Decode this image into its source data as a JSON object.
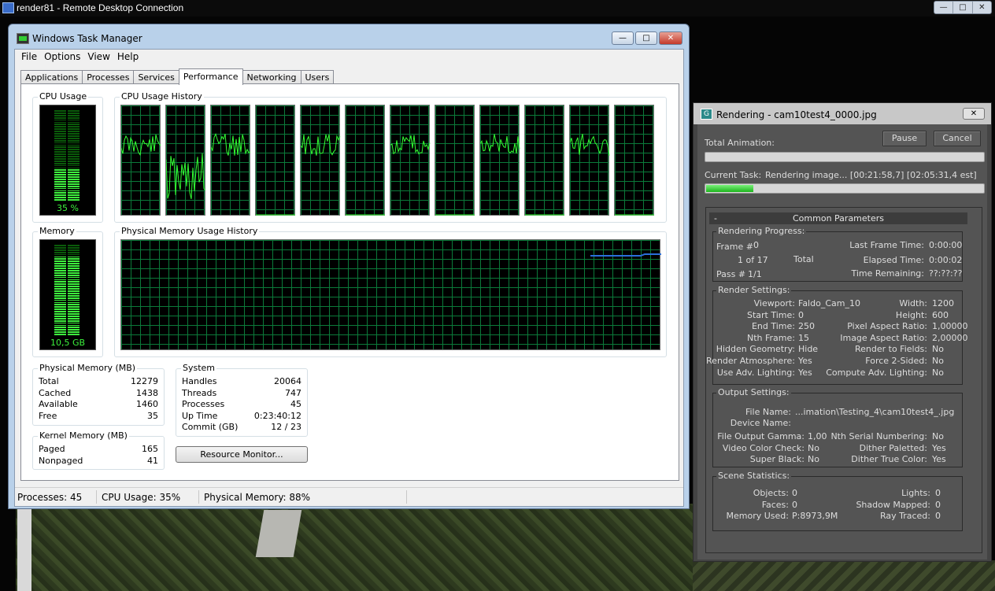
{
  "rdp": {
    "title": "render81 - Remote Desktop Connection",
    "buttons": [
      "—",
      "□",
      "✕"
    ]
  },
  "taskmanager": {
    "title": "Windows Task Manager",
    "controls": [
      "—",
      "□",
      "✕"
    ],
    "menu": [
      "File",
      "Options",
      "View",
      "Help"
    ],
    "tabs": [
      "Applications",
      "Processes",
      "Services",
      "Performance",
      "Networking",
      "Users"
    ],
    "active_tab": "Performance",
    "cpu_usage": {
      "label": "CPU Usage",
      "value": "35 %",
      "level": 0.35
    },
    "cpu_history": {
      "label": "CPU Usage History",
      "cores": 12
    },
    "memory": {
      "label": "Memory",
      "value": "10,5 GB",
      "level": 0.88
    },
    "mem_history": {
      "label": "Physical Memory Usage History"
    },
    "physical_memory": {
      "label": "Physical Memory (MB)",
      "rows": [
        {
          "k": "Total",
          "v": "12279"
        },
        {
          "k": "Cached",
          "v": "1438"
        },
        {
          "k": "Available",
          "v": "1460"
        },
        {
          "k": "Free",
          "v": "35"
        }
      ]
    },
    "system": {
      "label": "System",
      "rows": [
        {
          "k": "Handles",
          "v": "20064"
        },
        {
          "k": "Threads",
          "v": "747"
        },
        {
          "k": "Processes",
          "v": "45"
        },
        {
          "k": "Up Time",
          "v": "0:23:40:12"
        },
        {
          "k": "Commit (GB)",
          "v": "12 / 23"
        }
      ]
    },
    "kernel_memory": {
      "label": "Kernel Memory (MB)",
      "rows": [
        {
          "k": "Paged",
          "v": "165"
        },
        {
          "k": "Nonpaged",
          "v": "41"
        }
      ]
    },
    "resource_monitor_label": "Resource Monitor...",
    "status": {
      "processes": "Processes: 45",
      "cpu": "CPU Usage: 35%",
      "memory": "Physical Memory: 88%"
    }
  },
  "render": {
    "title": "Rendering - cam10test4_0000.jpg",
    "close": "✕",
    "pause_label": "Pause",
    "cancel_label": "Cancel",
    "total_animation_label": "Total Animation:",
    "total_progress": 0.0,
    "current_task_label": "Current Task:",
    "current_task_value": "Rendering image... [00:21:58,7] [02:05:31,4 est]",
    "task_progress": 0.17,
    "rollout_title": "Common Parameters",
    "rollout_toggle": "-",
    "progress": {
      "title": "Rendering Progress:",
      "frame_label": "Frame #",
      "frame_value": "0",
      "of_value": "1 of 17",
      "total_label": "Total",
      "pass_label": "Pass #",
      "pass_value": "1/1",
      "last_frame_label": "Last Frame Time:",
      "last_frame_value": "0:00:00",
      "elapsed_label": "Elapsed Time:",
      "elapsed_value": "0:00:02",
      "remaining_label": "Time Remaining:",
      "remaining_value": "??:??:??"
    },
    "settings": {
      "title": "Render Settings:",
      "left": [
        {
          "k": "Viewport:",
          "v": "Faldo_Cam_10"
        },
        {
          "k": "Start Time:",
          "v": "0"
        },
        {
          "k": "End Time:",
          "v": "250"
        },
        {
          "k": "Nth Frame:",
          "v": "15"
        },
        {
          "k": "Hidden Geometry:",
          "v": "Hide"
        },
        {
          "k": "Render Atmosphere:",
          "v": "Yes"
        },
        {
          "k": "Use Adv. Lighting:",
          "v": "Yes"
        }
      ],
      "right": [
        {
          "k": "Width:",
          "v": "1200"
        },
        {
          "k": "Height:",
          "v": "600"
        },
        {
          "k": "Pixel Aspect Ratio:",
          "v": "1,00000"
        },
        {
          "k": "Image Aspect Ratio:",
          "v": "2,00000"
        },
        {
          "k": "Render to Fields:",
          "v": "No"
        },
        {
          "k": "Force 2-Sided:",
          "v": "No"
        },
        {
          "k": "Compute Adv. Lighting:",
          "v": "No"
        }
      ]
    },
    "output": {
      "title": "Output Settings:",
      "file_name_label": "File Name:",
      "file_name_value": "...imation\\Testing_4\\cam10test4_.jpg",
      "device_label": "Device Name:",
      "device_value": "",
      "left": [
        {
          "k": "File Output Gamma:",
          "v": "1,00"
        },
        {
          "k": "Video Color Check:",
          "v": "No"
        },
        {
          "k": "Super Black:",
          "v": "No"
        }
      ],
      "right": [
        {
          "k": "Nth Serial Numbering:",
          "v": "No"
        },
        {
          "k": "Dither Paletted:",
          "v": "Yes"
        },
        {
          "k": "Dither True Color:",
          "v": "Yes"
        }
      ]
    },
    "scene": {
      "title": "Scene Statistics:",
      "left": [
        {
          "k": "Objects:",
          "v": "0"
        },
        {
          "k": "Faces:",
          "v": "0"
        },
        {
          "k": "Memory Used:",
          "v": "P:8973,9M"
        }
      ],
      "right": [
        {
          "k": "Lights:",
          "v": "0"
        },
        {
          "k": "Shadow Mapped:",
          "v": "0"
        },
        {
          "k": "Ray Traced:",
          "v": "0"
        }
      ]
    }
  }
}
